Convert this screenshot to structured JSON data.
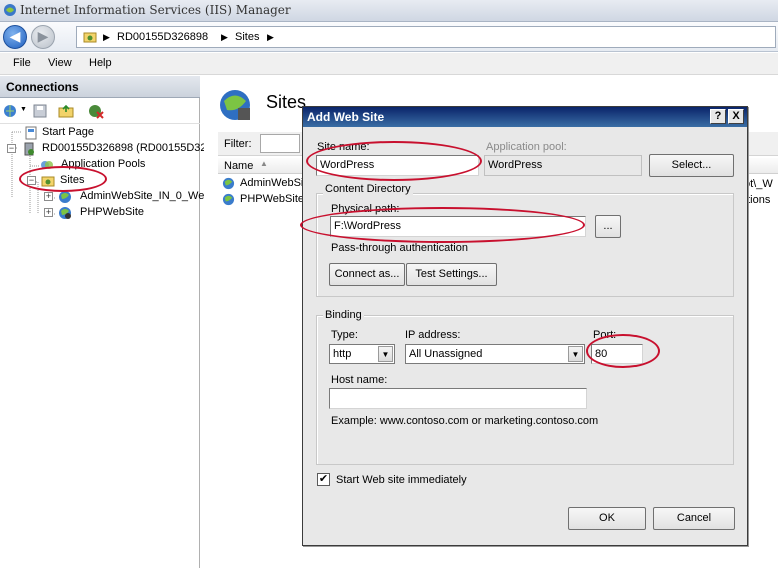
{
  "window": {
    "title": "Internet Information Services (IIS) Manager"
  },
  "address": {
    "crumbs": [
      "RD00155D326898",
      "Sites"
    ]
  },
  "menu": {
    "items": [
      "File",
      "View",
      "Help"
    ]
  },
  "connections": {
    "header": "Connections",
    "tree": [
      {
        "label": "Start Page"
      },
      {
        "label": "RD00155D326898 (RD00155D32"
      },
      {
        "label": "Application Pools"
      },
      {
        "label": "Sites"
      },
      {
        "label": "AdminWebSite_IN_0_We"
      },
      {
        "label": "PHPWebSite"
      }
    ]
  },
  "main": {
    "title": "Sites",
    "filter_label": "Filter:",
    "name_col": "Name",
    "rows": [
      "AdminWebSit",
      "PHPWebSite"
    ],
    "right_text": [
      "ot\\_W",
      "ations"
    ]
  },
  "dialog": {
    "title": "Add Web Site",
    "help_btn": "?",
    "close_btn": "X",
    "site_name_label": "Site name:",
    "site_name_value": "WordPress",
    "app_pool_label": "Application pool:",
    "app_pool_value": "WordPress",
    "select_btn": "Select...",
    "content_dir_title": "Content Directory",
    "physical_path_label": "Physical path:",
    "physical_path_value": "F:\\WordPress",
    "browse_btn": "...",
    "passthrough_label": "Pass-through authentication",
    "connect_as_btn": "Connect as...",
    "test_settings_btn": "Test Settings...",
    "binding_title": "Binding",
    "type_label": "Type:",
    "type_value": "http",
    "ip_label": "IP address:",
    "ip_value": "All Unassigned",
    "port_label": "Port:",
    "port_value": "80",
    "host_label": "Host name:",
    "host_value": "",
    "example_text": "Example: www.contoso.com or marketing.contoso.com",
    "start_immediately_label": "Start Web site immediately",
    "start_immediately_checked": "✔",
    "ok_btn": "OK",
    "cancel_btn": "Cancel"
  },
  "colors": {
    "annotation": "#c8102e",
    "dialog_title": "#0a246a"
  }
}
